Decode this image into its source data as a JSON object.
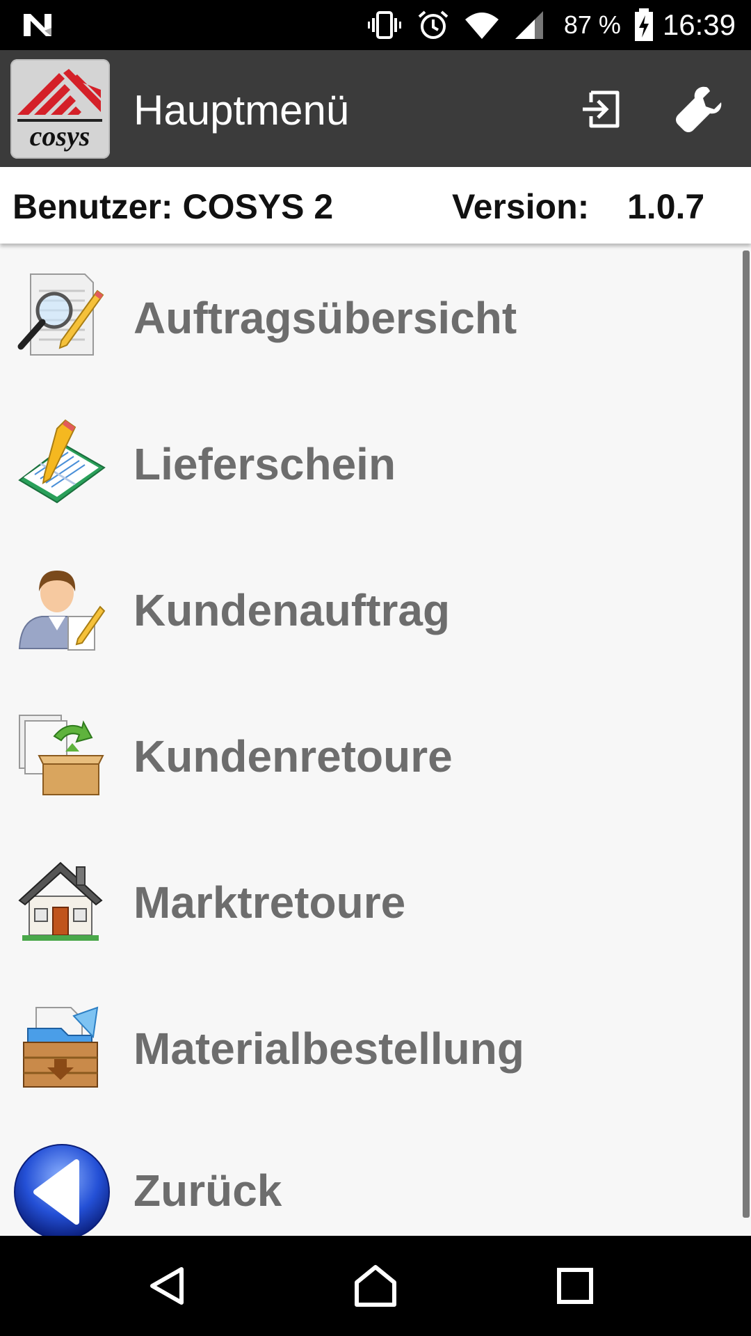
{
  "status_bar": {
    "battery_percent": "87 %",
    "time": "16:39",
    "icons": [
      "n-notification-icon",
      "vibrate-icon",
      "alarm-icon",
      "wifi-icon",
      "cell-signal-icon",
      "battery-charging-icon"
    ]
  },
  "app_bar": {
    "title": "Hauptmenü",
    "logo_text": "cosys",
    "actions": [
      "logout-icon",
      "settings-wrench-icon"
    ]
  },
  "info": {
    "user": "Benutzer: COSYS 2",
    "version_label": "Version:",
    "version_value": "1.0.7"
  },
  "menu": {
    "items": [
      {
        "label": "Auftragsübersicht",
        "icon": "document-search-icon"
      },
      {
        "label": "Lieferschein",
        "icon": "notebook-pencil-icon"
      },
      {
        "label": "Kundenauftrag",
        "icon": "customer-order-icon"
      },
      {
        "label": "Kundenretoure",
        "icon": "customer-return-icon"
      },
      {
        "label": "Marktretoure",
        "icon": "house-icon"
      },
      {
        "label": "Materialbestellung",
        "icon": "material-box-icon"
      },
      {
        "label": "Zurück",
        "icon": "back-arrow-icon"
      }
    ]
  },
  "colors": {
    "app_bar": "#3b3b3b",
    "menu_text": "#6d6d6d",
    "background": "#f7f7f7",
    "brand_red": "#d42028"
  }
}
